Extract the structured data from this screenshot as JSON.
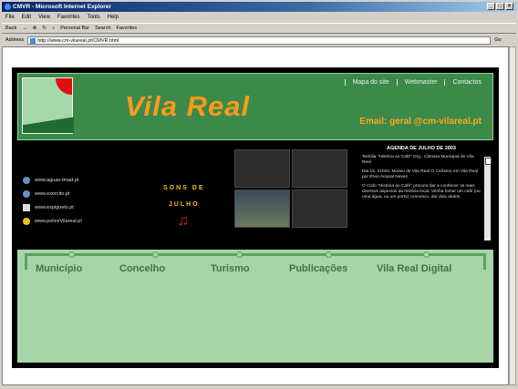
{
  "window": {
    "title": "CMVR - Microsoft Internet Explorer",
    "menu": [
      "File",
      "Edit",
      "View",
      "Favorites",
      "Tools",
      "Help"
    ],
    "toolbar": [
      "Back",
      "Search",
      "Personal Bar",
      "Favorites"
    ],
    "address_label": "Address",
    "address": "http://www.cm-vilareal.pt/CMVR.html",
    "go_label": "Go"
  },
  "site": {
    "brand": "Vila Real",
    "topnav": [
      "Mapa do site",
      "Webmaster",
      "Contactos"
    ],
    "email": "Email: geral @cm-vilareal.pt",
    "links": [
      "www.aguas-tmad.pt",
      "www.exercito.pt",
      "www.espiguelo.pt",
      "www.policeVilareal.pt"
    ],
    "sons": {
      "line1": "SONS DE",
      "line2": "JULHO",
      "note": "♫"
    },
    "agenda": {
      "title": "AGENDA DE JULHO DE 2003",
      "items": [
        "Tertúlia \"História ao Café\" Org.: Câmara Municipal de Vila Real",
        "Dia 15, 21h00, Museu de Vila Real O Ciclismo em Vila Real por Élvio Amaral Neves",
        "O Ciclo \"História ao Café\" procura dar a conhecer os mais diversos aspectos da história local. Venha tomar um café (ou uma água, ou um porto) connosco, dar dois dedos"
      ]
    },
    "menu": [
      "Município",
      "Concelho",
      "Turismo",
      "Publicações",
      "Vila Real Digital"
    ]
  }
}
